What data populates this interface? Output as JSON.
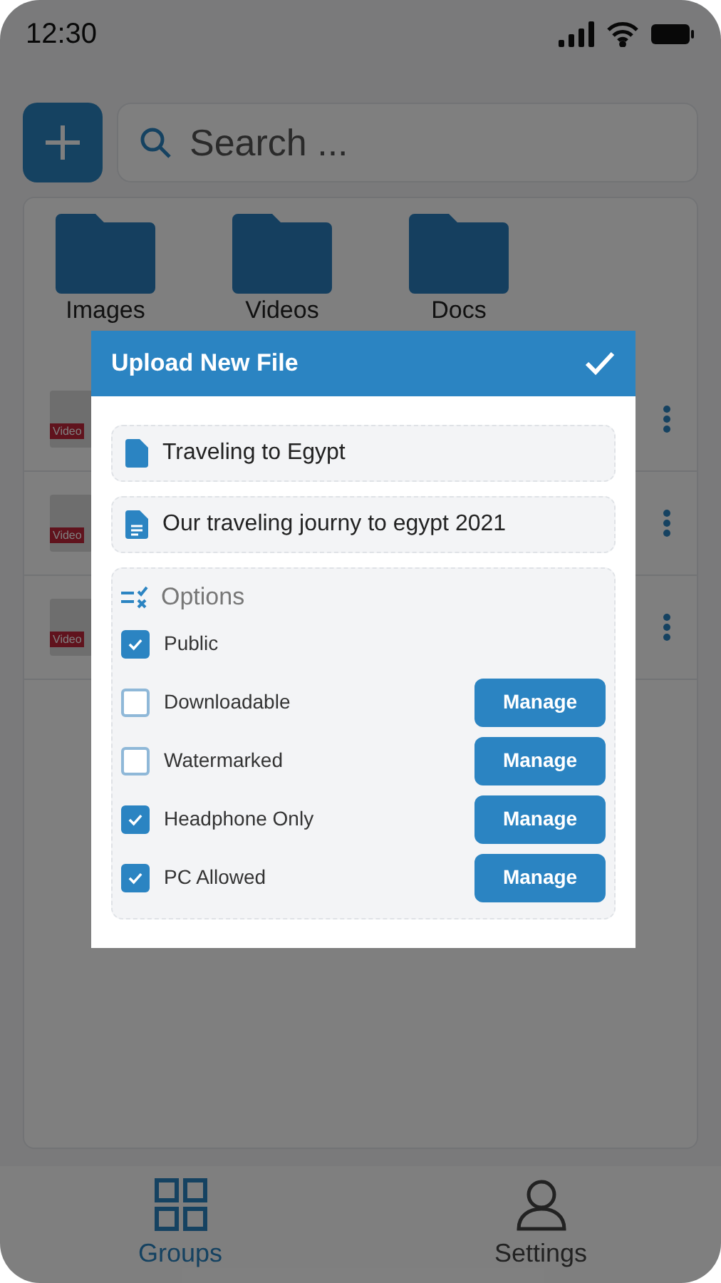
{
  "status_bar": {
    "time": "12:30"
  },
  "search": {
    "placeholder": "Search ..."
  },
  "folders": [
    {
      "label": "Images"
    },
    {
      "label": "Videos"
    },
    {
      "label": "Docs"
    }
  ],
  "files": [
    {
      "tag": "Video"
    },
    {
      "tag": "Video"
    },
    {
      "tag": "Video"
    }
  ],
  "dialog": {
    "title": "Upload New File",
    "fields": [
      {
        "kind": "title",
        "value": "Traveling to Egypt"
      },
      {
        "kind": "description",
        "value": "Our traveling journy to egypt 2021"
      }
    ],
    "options_label": "Options",
    "options": [
      {
        "label": "Public",
        "checked": true
      },
      {
        "label": "Downloadable",
        "checked": false,
        "action": "Manage"
      },
      {
        "label": "Watermarked",
        "checked": false,
        "action": "Manage"
      },
      {
        "label": "Headphone Only",
        "checked": true,
        "action": "Manage"
      },
      {
        "label": "PC Allowed",
        "checked": true,
        "action": "Manage"
      }
    ]
  },
  "nav": [
    {
      "label": "Groups",
      "selected": true
    },
    {
      "label": "Settings",
      "selected": false
    }
  ]
}
